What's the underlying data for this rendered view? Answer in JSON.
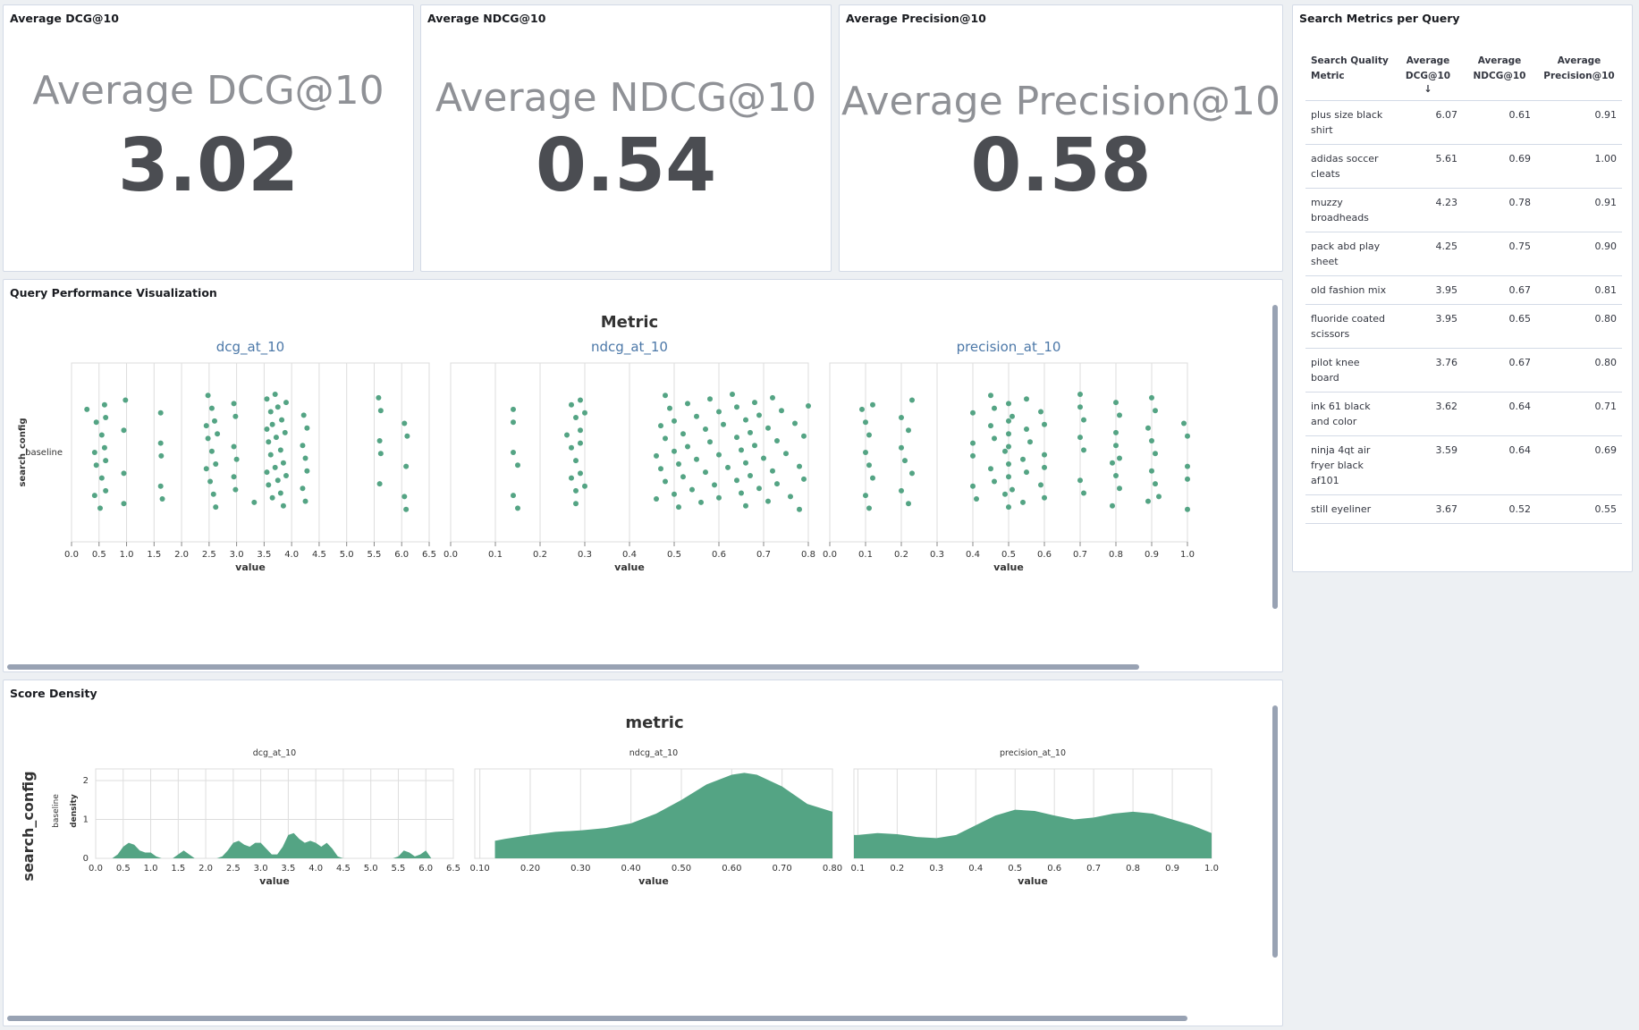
{
  "panels": {
    "dcg": {
      "title": "Average DCG@10",
      "label": "Average DCG@10",
      "value": "3.02"
    },
    "ndcg": {
      "title": "Average NDCG@10",
      "label": "Average NDCG@10",
      "value": "0.54"
    },
    "precision": {
      "title": "Average Precision@10",
      "label": "Average Precision@10",
      "value": "0.58"
    },
    "table": {
      "title": "Search Metrics per Query",
      "headers": [
        "Search Quality Metric",
        "Average DCG@10",
        "Average NDCG@10",
        "Average Precision@10"
      ],
      "sort_icon": "arrow-down-icon",
      "rows": [
        {
          "query": "plus size black shirt",
          "dcg": "6.07",
          "ndcg": "0.61",
          "precision": "0.91"
        },
        {
          "query": "adidas soccer cleats",
          "dcg": "5.61",
          "ndcg": "0.69",
          "precision": "1.00"
        },
        {
          "query": "muzzy broadheads",
          "dcg": "4.23",
          "ndcg": "0.78",
          "precision": "0.91"
        },
        {
          "query": "pack abd play sheet",
          "dcg": "4.25",
          "ndcg": "0.75",
          "precision": "0.90"
        },
        {
          "query": "old fashion mix",
          "dcg": "3.95",
          "ndcg": "0.67",
          "precision": "0.81"
        },
        {
          "query": "fluoride coated scissors",
          "dcg": "3.95",
          "ndcg": "0.65",
          "precision": "0.80"
        },
        {
          "query": "pilot knee board",
          "dcg": "3.76",
          "ndcg": "0.67",
          "precision": "0.80"
        },
        {
          "query": "ink 61 black and color",
          "dcg": "3.62",
          "ndcg": "0.64",
          "precision": "0.71"
        },
        {
          "query": "ninja 4qt air fryer black af101",
          "dcg": "3.59",
          "ndcg": "0.64",
          "precision": "0.69"
        },
        {
          "query": "still eyeliner",
          "dcg": "3.67",
          "ndcg": "0.52",
          "precision": "0.55"
        }
      ]
    },
    "strip": {
      "title": "Query Performance Visualization"
    },
    "density": {
      "title": "Score Density"
    }
  },
  "colors": {
    "mark": "#54a484",
    "grid": "#dddddd",
    "facet_title": "#4c78a8"
  },
  "chart_data": [
    {
      "type": "scatter",
      "title": "Metric",
      "ylabel": "search_config",
      "ycategories": [
        "baseline"
      ],
      "facets": [
        {
          "name": "dcg_at_10",
          "xlabel": "value",
          "xlim": [
            0,
            6.5
          ],
          "xticks": [
            "0.0",
            "0.5",
            "1.0",
            "1.5",
            "2.0",
            "2.5",
            "3.0",
            "3.5",
            "4.0",
            "4.5",
            "5.0",
            "5.5",
            "6.0",
            "6.5"
          ],
          "tick_step": 0.5,
          "points": [
            0.28,
            0.42,
            0.42,
            0.45,
            0.45,
            0.52,
            0.55,
            0.55,
            0.6,
            0.6,
            0.62,
            0.62,
            0.62,
            0.95,
            0.95,
            0.95,
            0.98,
            1.62,
            1.62,
            1.62,
            1.63,
            1.65,
            2.45,
            2.45,
            2.48,
            2.48,
            2.52,
            2.55,
            2.55,
            2.58,
            2.6,
            2.62,
            2.62,
            2.65,
            2.95,
            2.95,
            2.95,
            2.98,
            2.98,
            3.0,
            3.32,
            3.55,
            3.55,
            3.55,
            3.58,
            3.58,
            3.62,
            3.62,
            3.65,
            3.65,
            3.7,
            3.7,
            3.72,
            3.75,
            3.75,
            3.8,
            3.8,
            3.82,
            3.85,
            3.85,
            3.88,
            3.9,
            3.9,
            4.2,
            4.2,
            4.22,
            4.25,
            4.25,
            4.28,
            4.28,
            5.58,
            5.6,
            5.6,
            5.62,
            5.62,
            6.05,
            6.05,
            6.08,
            6.08,
            6.1
          ]
        },
        {
          "name": "ndcg_at_10",
          "xlabel": "value",
          "xlim": [
            0,
            0.8
          ],
          "xticks": [
            "0.0",
            "0.1",
            "0.2",
            "0.3",
            "0.4",
            "0.5",
            "0.6",
            "0.7",
            "0.8"
          ],
          "tick_step": 0.1,
          "points": [
            0.14,
            0.14,
            0.14,
            0.14,
            0.15,
            0.15,
            0.26,
            0.27,
            0.27,
            0.27,
            0.28,
            0.28,
            0.28,
            0.28,
            0.29,
            0.29,
            0.29,
            0.29,
            0.3,
            0.3,
            0.46,
            0.46,
            0.47,
            0.47,
            0.48,
            0.48,
            0.48,
            0.49,
            0.5,
            0.5,
            0.5,
            0.51,
            0.51,
            0.52,
            0.52,
            0.53,
            0.53,
            0.54,
            0.55,
            0.55,
            0.56,
            0.57,
            0.57,
            0.58,
            0.58,
            0.59,
            0.6,
            0.6,
            0.6,
            0.61,
            0.62,
            0.63,
            0.64,
            0.64,
            0.64,
            0.65,
            0.65,
            0.66,
            0.66,
            0.66,
            0.67,
            0.67,
            0.68,
            0.68,
            0.69,
            0.69,
            0.7,
            0.71,
            0.71,
            0.72,
            0.72,
            0.73,
            0.73,
            0.74,
            0.75,
            0.76,
            0.77,
            0.78,
            0.78,
            0.79,
            0.79,
            0.8
          ]
        },
        {
          "name": "precision_at_10",
          "xlabel": "value",
          "xlim": [
            0,
            1.0
          ],
          "xticks": [
            "0.0",
            "0.1",
            "0.2",
            "0.3",
            "0.4",
            "0.5",
            "0.6",
            "0.7",
            "0.8",
            "0.9",
            "1.0"
          ],
          "tick_step": 0.1,
          "points": [
            0.09,
            0.1,
            0.1,
            0.1,
            0.11,
            0.11,
            0.11,
            0.12,
            0.12,
            0.2,
            0.2,
            0.2,
            0.21,
            0.22,
            0.22,
            0.23,
            0.23,
            0.4,
            0.4,
            0.4,
            0.4,
            0.41,
            0.45,
            0.45,
            0.45,
            0.46,
            0.46,
            0.46,
            0.49,
            0.49,
            0.5,
            0.5,
            0.5,
            0.5,
            0.5,
            0.5,
            0.5,
            0.51,
            0.51,
            0.54,
            0.54,
            0.55,
            0.55,
            0.55,
            0.56,
            0.59,
            0.59,
            0.6,
            0.6,
            0.6,
            0.6,
            0.7,
            0.7,
            0.7,
            0.7,
            0.71,
            0.71,
            0.71,
            0.79,
            0.79,
            0.8,
            0.8,
            0.8,
            0.8,
            0.81,
            0.81,
            0.81,
            0.89,
            0.89,
            0.9,
            0.9,
            0.9,
            0.91,
            0.91,
            0.91,
            0.92,
            0.99,
            1.0,
            1.0,
            1.0,
            1.0
          ]
        }
      ]
    },
    {
      "type": "area",
      "title": "metric",
      "ylabel": "search_config",
      "row_label": "baseline",
      "density_label": "density",
      "facets": [
        {
          "name": "dcg_at_10",
          "xlabel": "value",
          "xlim": [
            0,
            6.5
          ],
          "ylim": [
            0,
            2.3
          ],
          "yticks": [
            "0",
            "1",
            "2"
          ],
          "xticks": [
            "0.0",
            "0.5",
            "1.0",
            "1.5",
            "2.0",
            "2.5",
            "3.0",
            "3.5",
            "4.0",
            "4.5",
            "5.0",
            "5.5",
            "6.0",
            "6.5"
          ],
          "tick_step": 0.5,
          "x": [
            0.3,
            0.4,
            0.5,
            0.6,
            0.7,
            0.8,
            0.9,
            1.0,
            1.1,
            1.2,
            1.3,
            1.4,
            1.5,
            1.6,
            1.7,
            1.8,
            1.9,
            2.0,
            2.1,
            2.2,
            2.3,
            2.4,
            2.5,
            2.6,
            2.7,
            2.8,
            2.9,
            3.0,
            3.1,
            3.2,
            3.3,
            3.4,
            3.5,
            3.6,
            3.7,
            3.8,
            3.9,
            4.0,
            4.1,
            4.2,
            4.3,
            4.4,
            4.5,
            4.6,
            4.7,
            4.8,
            4.9,
            5.0,
            5.1,
            5.2,
            5.3,
            5.4,
            5.5,
            5.6,
            5.7,
            5.8,
            5.9,
            6.0,
            6.1
          ],
          "y": [
            0.0,
            0.1,
            0.3,
            0.4,
            0.35,
            0.2,
            0.15,
            0.15,
            0.05,
            0.0,
            0.0,
            0.0,
            0.1,
            0.2,
            0.1,
            0.0,
            0.0,
            0.0,
            0.0,
            0.0,
            0.05,
            0.2,
            0.4,
            0.45,
            0.35,
            0.3,
            0.4,
            0.4,
            0.25,
            0.1,
            0.1,
            0.3,
            0.6,
            0.65,
            0.5,
            0.4,
            0.45,
            0.4,
            0.3,
            0.4,
            0.25,
            0.05,
            0.0,
            0.0,
            0.0,
            0.0,
            0.0,
            0.0,
            0.0,
            0.0,
            0.0,
            0.0,
            0.05,
            0.2,
            0.15,
            0.05,
            0.1,
            0.2,
            0.0
          ]
        },
        {
          "name": "ndcg_at_10",
          "xlabel": "value",
          "xlim": [
            0.09,
            0.8
          ],
          "ylim": [
            0,
            2.3
          ],
          "yticks": [],
          "xticks": [
            "0.10",
            "0.20",
            "0.30",
            "0.40",
            "0.50",
            "0.60",
            "0.70",
            "0.80"
          ],
          "tick_start": 0.1,
          "tick_step": 0.1,
          "x": [
            0.13,
            0.15,
            0.2,
            0.25,
            0.3,
            0.35,
            0.4,
            0.45,
            0.5,
            0.55,
            0.6,
            0.625,
            0.65,
            0.7,
            0.75,
            0.8
          ],
          "y": [
            0.45,
            0.5,
            0.6,
            0.68,
            0.72,
            0.78,
            0.9,
            1.15,
            1.5,
            1.9,
            2.15,
            2.2,
            2.15,
            1.85,
            1.4,
            1.2
          ]
        },
        {
          "name": "precision_at_10",
          "xlabel": "value",
          "xlim": [
            0.09,
            1.0
          ],
          "ylim": [
            0,
            2.3
          ],
          "yticks": [],
          "xticks": [
            "0.1",
            "0.2",
            "0.3",
            "0.4",
            "0.5",
            "0.6",
            "0.7",
            "0.8",
            "0.9",
            "1.0"
          ],
          "tick_start": 0.1,
          "tick_step": 0.1,
          "x": [
            0.09,
            0.1,
            0.15,
            0.2,
            0.25,
            0.3,
            0.35,
            0.4,
            0.45,
            0.5,
            0.55,
            0.6,
            0.65,
            0.7,
            0.75,
            0.8,
            0.85,
            0.9,
            0.95,
            1.0
          ],
          "y": [
            0.6,
            0.6,
            0.65,
            0.62,
            0.55,
            0.52,
            0.6,
            0.85,
            1.1,
            1.25,
            1.22,
            1.1,
            1.0,
            1.05,
            1.15,
            1.2,
            1.15,
            1.0,
            0.85,
            0.65
          ]
        }
      ]
    }
  ]
}
